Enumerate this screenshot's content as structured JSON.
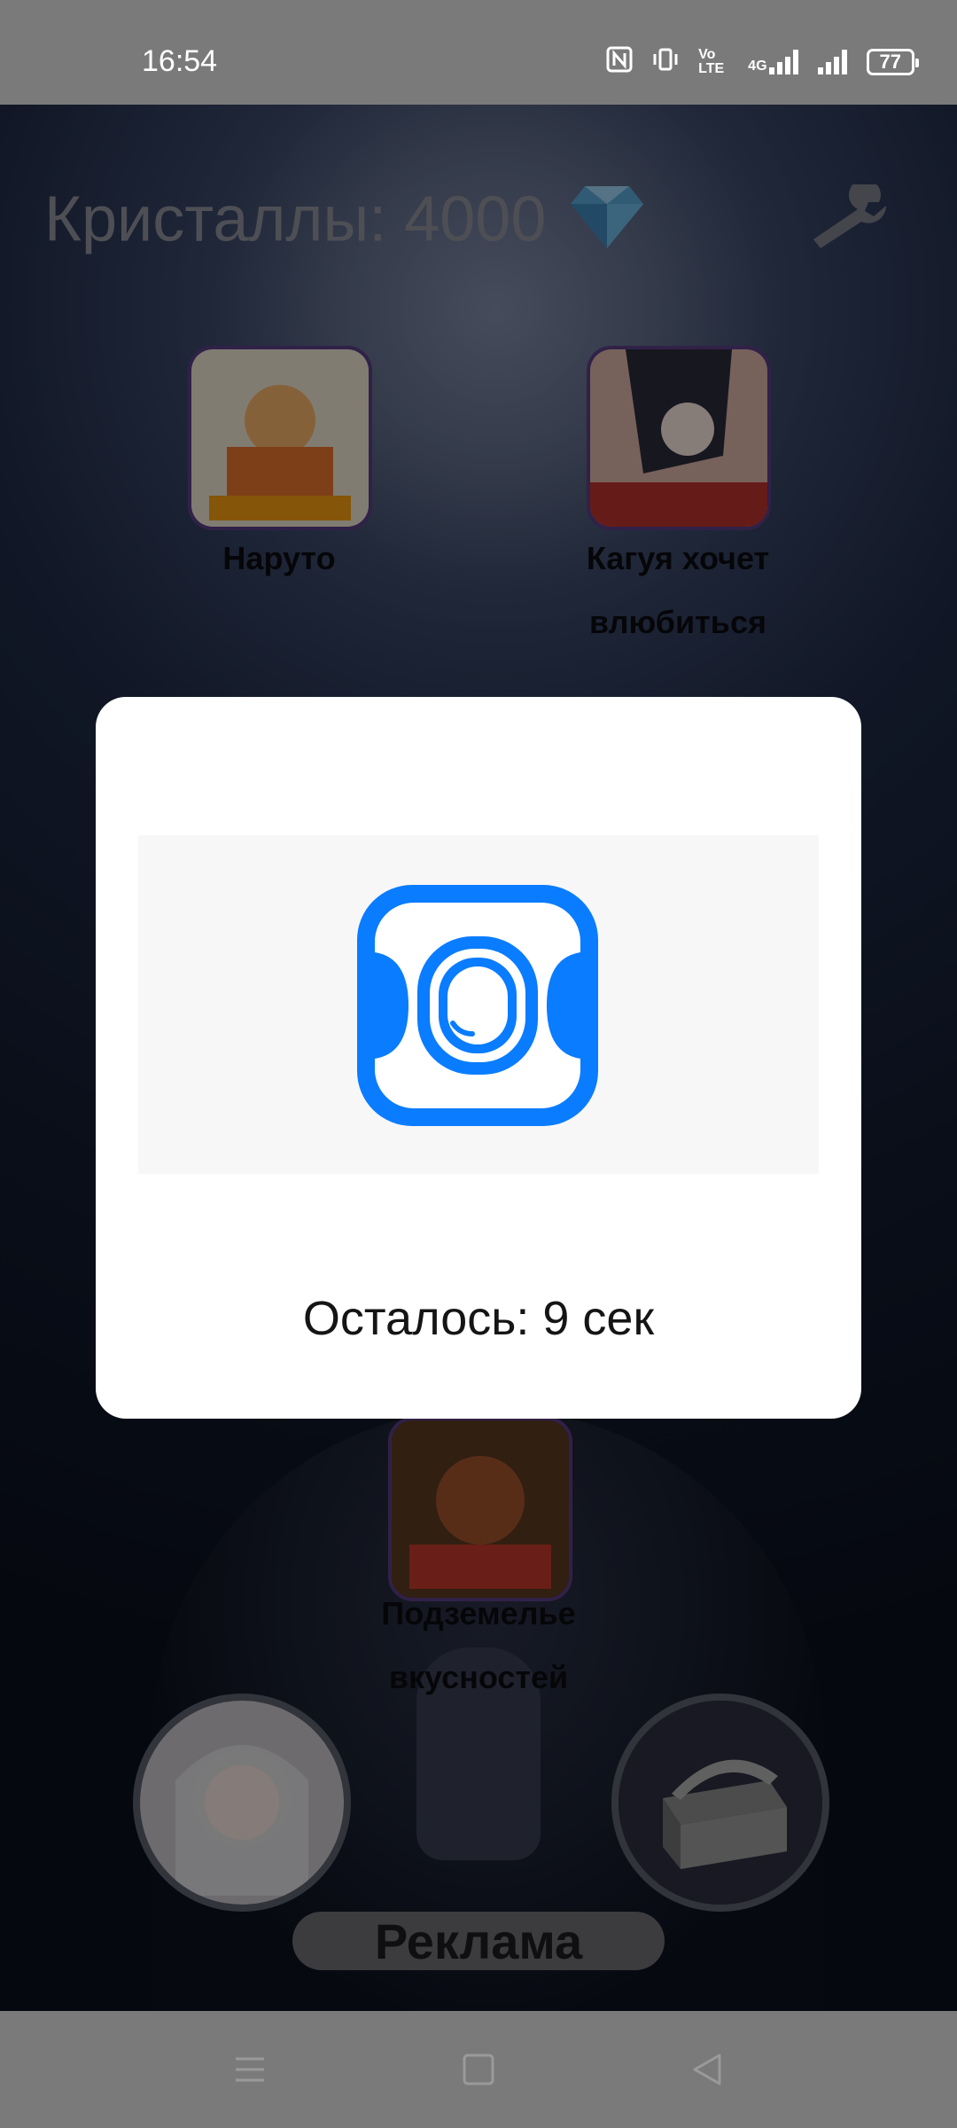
{
  "status_bar": {
    "time": "16:54",
    "network_label": "4G",
    "volte_label": "Vo LTE",
    "battery": "77"
  },
  "header": {
    "crystals_text": "Кристаллы: 4000",
    "diamond_icon": "diamond-icon",
    "settings_icon": "wrench-icon"
  },
  "titles": [
    {
      "name": "Наруто"
    },
    {
      "name": "Кагуя хочет влюбиться"
    },
    {
      "name": "Подземелье вкусностей"
    }
  ],
  "bottom": {
    "ad_button_label": "Реклама"
  },
  "modal": {
    "countdown": "Осталось: 9 сек",
    "ad_icon": "vk-video-app-icon"
  },
  "nav": {
    "menu_icon": "menu-icon",
    "home_icon": "home-square-icon",
    "back_icon": "back-triangle-icon"
  },
  "colors": {
    "accent_blue": "#0077ff",
    "card_border": "#5a3c83",
    "system_bar": "#7a7a7a"
  }
}
